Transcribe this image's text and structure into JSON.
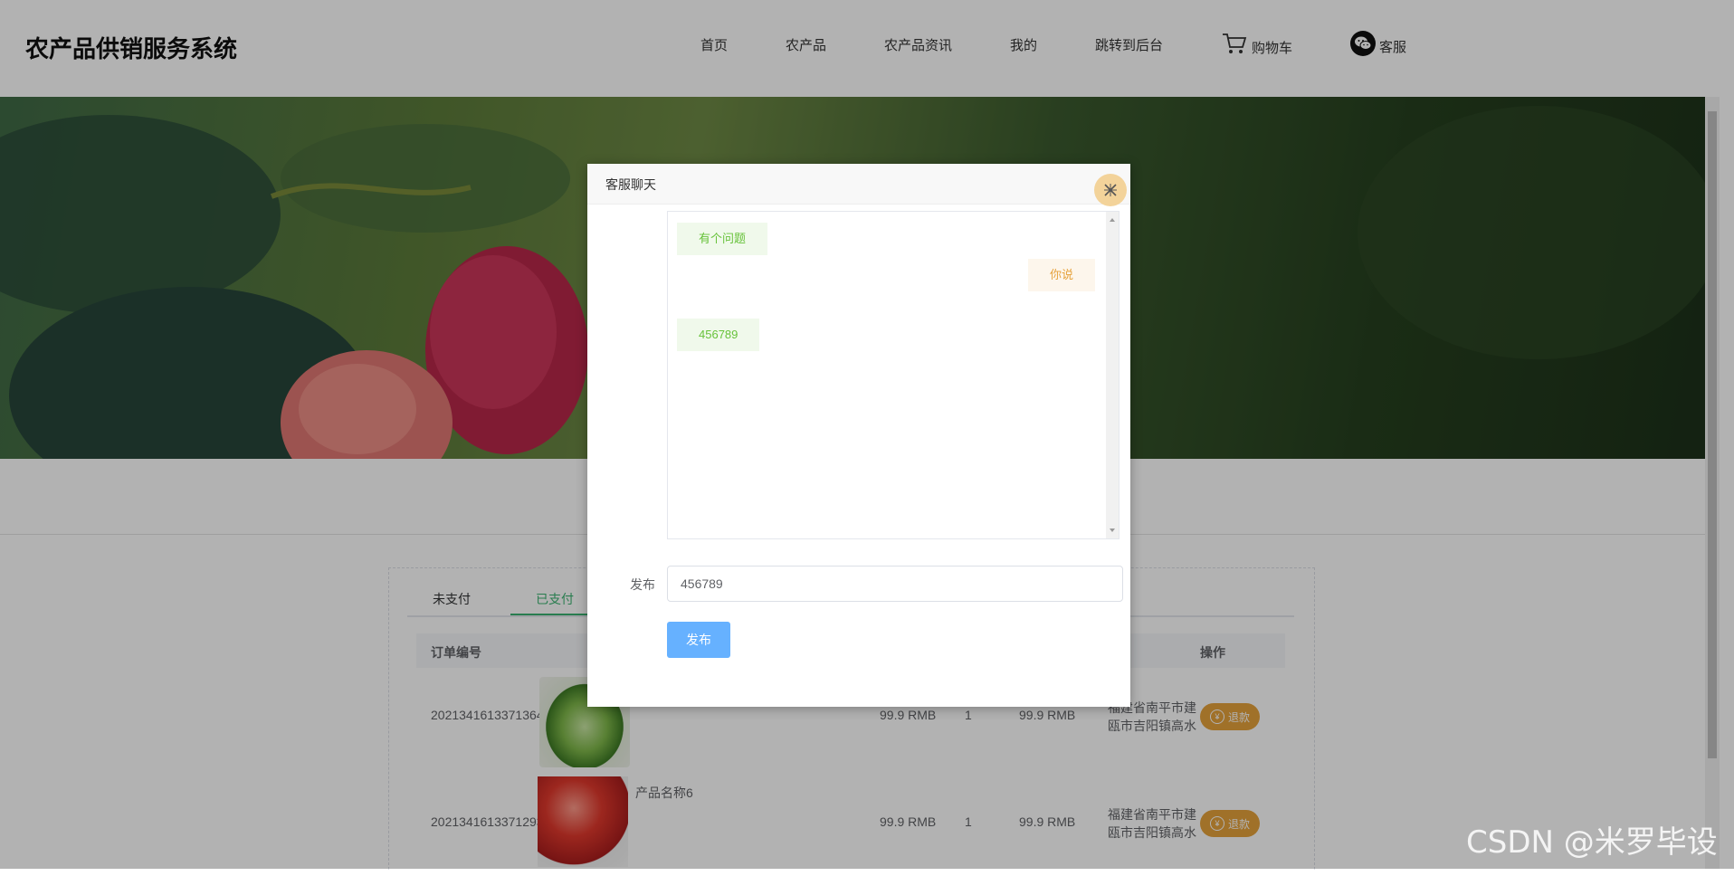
{
  "header": {
    "site_title": "农产品供销服务系统",
    "nav": [
      "首页",
      "农产品",
      "农产品资讯",
      "我的",
      "跳转到后台"
    ],
    "cart_label": "购物车",
    "service_label": "客服"
  },
  "orders": {
    "tabs": [
      "未支付",
      "已支付"
    ],
    "active_tab": "已支付",
    "columns": {
      "order_no": "订单编号",
      "action": "操作"
    },
    "rows": [
      {
        "order_no": "20213416133713644427",
        "product": "",
        "price": "99.9 RMB",
        "qty": "1",
        "total": "99.9 RMB",
        "address": "福建省南平市建瓯市吉阳镇高水",
        "action": "退款"
      },
      {
        "order_no": "20213416133712934195",
        "product": "产品名称6",
        "price": "99.9 RMB",
        "qty": "1",
        "total": "99.9 RMB",
        "address": "福建省南平市建瓯市吉阳镇高水",
        "action": "退款"
      }
    ]
  },
  "dialog": {
    "title": "客服聊天",
    "messages": [
      {
        "side": "left",
        "text": "有个问题"
      },
      {
        "side": "right",
        "text": "你说"
      },
      {
        "side": "left",
        "text": "456789"
      }
    ],
    "input_label": "发布",
    "input_value": "456789",
    "submit_label": "发布"
  },
  "watermark": "CSDN @米罗毕设",
  "colors": {
    "accent_green": "#3cb371",
    "refund_orange": "#e6a23c",
    "submit_blue": "#66b1ff"
  }
}
